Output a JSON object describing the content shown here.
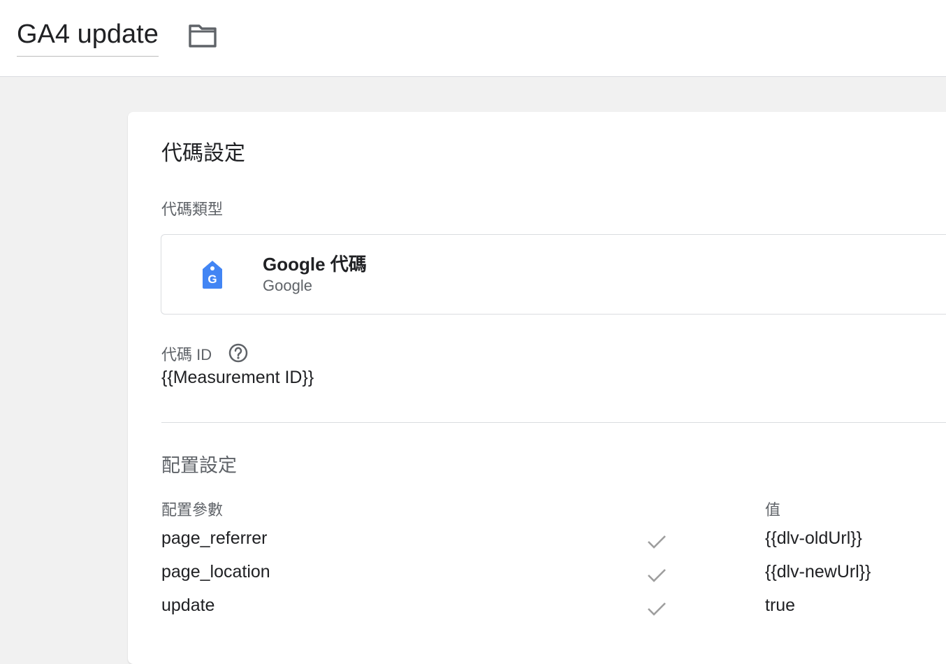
{
  "header": {
    "title": "GA4 update",
    "folder_icon": "folder-icon"
  },
  "card": {
    "title": "代碼設定",
    "tag_type_label": "代碼類型",
    "tag_type": {
      "name": "Google 代碼",
      "vendor": "Google",
      "icon": "google-tag-icon",
      "icon_color": "#4285f4"
    },
    "tag_id_label": "代碼 ID",
    "tag_id_value": "{{Measurement ID}}",
    "config_section_title": "配置設定",
    "config_table": {
      "headers": [
        "配置參數",
        "值"
      ],
      "rows": [
        {
          "parameter": "page_referrer",
          "checked": true,
          "value": "{{dlv-oldUrl}}"
        },
        {
          "parameter": "page_location",
          "checked": true,
          "value": "{{dlv-newUrl}}"
        },
        {
          "parameter": "update",
          "checked": true,
          "value": "true"
        }
      ]
    }
  }
}
